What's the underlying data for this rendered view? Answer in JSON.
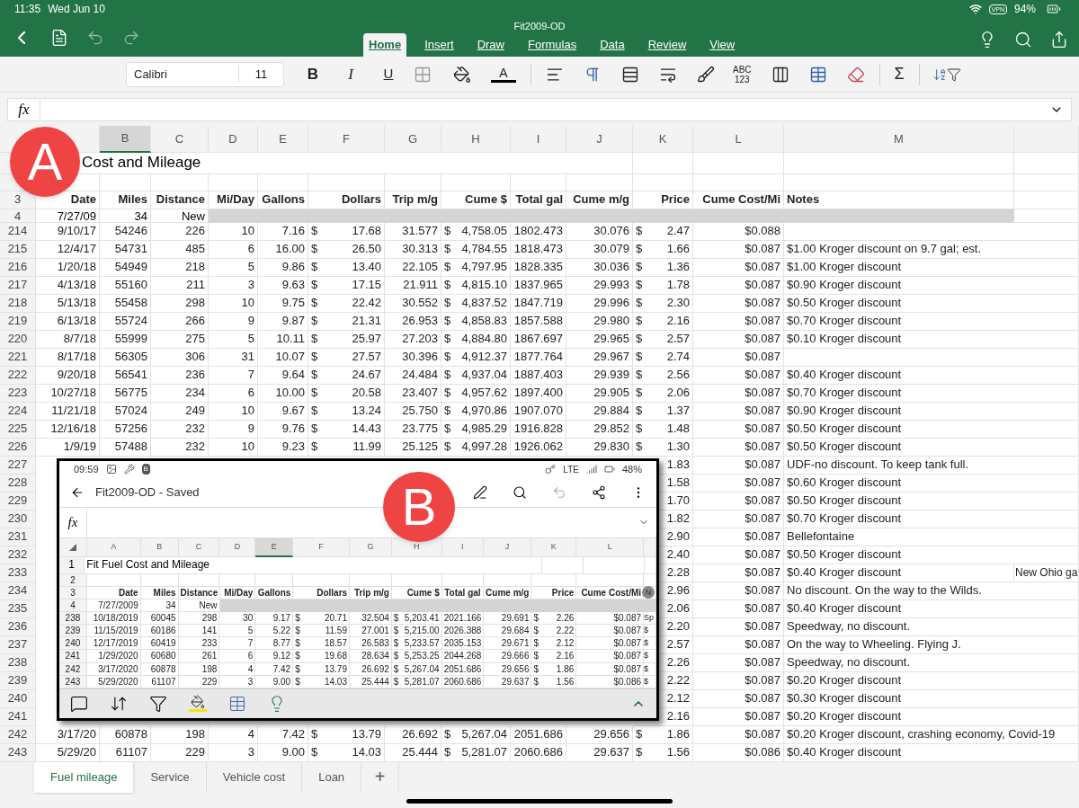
{
  "status_bar": {
    "time": "11:35",
    "date": "Wed Jun 10",
    "vpn": "VPN",
    "battery": "94%"
  },
  "title_bar": {
    "title": "Fit2009-OD"
  },
  "ribbon_tabs": [
    {
      "label": "Home",
      "selected": true
    },
    {
      "label": "Insert",
      "selected": false
    },
    {
      "label": "Draw",
      "selected": false
    },
    {
      "label": "Formulas",
      "selected": false
    },
    {
      "label": "Data",
      "selected": false
    },
    {
      "label": "Review",
      "selected": false
    },
    {
      "label": "View",
      "selected": false
    }
  ],
  "toolbar": {
    "font": "Calibri",
    "size": "11",
    "bold": "B",
    "italic": "I",
    "underline": "U",
    "font_color": "A",
    "spelling": "ABC",
    "numbers": "123",
    "sum": "Σ"
  },
  "formula_bar": {
    "label": "fx"
  },
  "callouts": [
    "A",
    "B"
  ],
  "grid": {
    "columns": [
      {
        "label": "B",
        "selected": true
      },
      {
        "label": "C",
        "selected": false
      },
      {
        "label": "D",
        "selected": false
      },
      {
        "label": "E",
        "selected": false
      },
      {
        "label": "F",
        "selected": false
      },
      {
        "label": "G",
        "selected": false
      },
      {
        "label": "H",
        "selected": false
      },
      {
        "label": "I",
        "selected": false
      },
      {
        "label": "J",
        "selected": false
      },
      {
        "label": "K",
        "selected": false
      },
      {
        "label": "L",
        "selected": false
      },
      {
        "label": "M",
        "selected": false
      }
    ],
    "title": "Cost and Mileage",
    "header_row": "3",
    "headers": [
      "Date",
      "Miles",
      "Distance",
      "Mi/Day",
      "Gallons",
      "Dollars",
      "Trip m/g",
      "Cume $",
      "Total gal",
      "Cume m/g",
      "Price",
      "Cume Cost/Mi",
      "Notes"
    ],
    "first_row": {
      "row": "4",
      "cells": [
        "7/27/09",
        "34",
        "New"
      ]
    },
    "rows": [
      {
        "kind": "full",
        "row": "214",
        "cells": [
          "9/10/17",
          "54246",
          "226",
          "10",
          "7.16",
          "$ 17.68",
          "31.577",
          "$ 4,758.05",
          "1802.473",
          "30.076",
          "$ 2.47",
          "$0.088"
        ]
      },
      {
        "kind": "full",
        "row": "215",
        "cells": [
          "12/4/17",
          "54731",
          "485",
          "6",
          "16.00",
          "$ 26.50",
          "30.313",
          "$ 4,784.55",
          "1818.473",
          "30.079",
          "$ 1.66",
          "$0.087"
        ],
        "note": "$1.00 Kroger discount on 9.7 gal; est."
      },
      {
        "kind": "full",
        "row": "216",
        "cells": [
          "1/20/18",
          "54949",
          "218",
          "5",
          "9.86",
          "$ 13.40",
          "22.105",
          "$ 4,797.95",
          "1828.335",
          "30.036",
          "$ 1.36",
          "$0.087"
        ],
        "note": "$1.00 Kroger discount"
      },
      {
        "kind": "full",
        "row": "217",
        "cells": [
          "4/13/18",
          "55160",
          "211",
          "3",
          "9.63",
          "$ 17.15",
          "21.911",
          "$ 4,815.10",
          "1837.965",
          "29.993",
          "$ 1.78",
          "$0.087"
        ],
        "note": "$0.90 Kroger discount"
      },
      {
        "kind": "full",
        "row": "218",
        "cells": [
          "5/13/18",
          "55458",
          "298",
          "10",
          "9.75",
          "$ 22.42",
          "30.552",
          "$ 4,837.52",
          "1847.719",
          "29.996",
          "$ 2.30",
          "$0.087"
        ],
        "note": "$0.50 Kroger discount"
      },
      {
        "kind": "full",
        "row": "219",
        "cells": [
          "6/13/18",
          "55724",
          "266",
          "9",
          "9.87",
          "$ 21.31",
          "26.953",
          "$ 4,858.83",
          "1857.588",
          "29.980",
          "$ 2.16",
          "$0.087"
        ],
        "note": "$0.70 Kroger discount"
      },
      {
        "kind": "full",
        "row": "220",
        "cells": [
          "8/7/18",
          "55999",
          "275",
          "5",
          "10.11",
          "$ 25.97",
          "27.203",
          "$ 4,884.80",
          "1867.697",
          "29.965",
          "$ 2.57",
          "$0.087"
        ],
        "note": "$0.10 Kroger discount"
      },
      {
        "kind": "full",
        "row": "221",
        "cells": [
          "8/17/18",
          "56305",
          "306",
          "31",
          "10.07",
          "$ 27.57",
          "30.396",
          "$ 4,912.37",
          "1877.764",
          "29.967",
          "$ 2.74",
          "$0.087"
        ]
      },
      {
        "kind": "full",
        "row": "222",
        "cells": [
          "9/20/18",
          "56541",
          "236",
          "7",
          "9.64",
          "$ 24.67",
          "24.484",
          "$ 4,937.04",
          "1887.403",
          "29.939",
          "$ 2.56",
          "$0.087"
        ],
        "note": "$0.40 Kroger discount"
      },
      {
        "kind": "full",
        "row": "223",
        "cells": [
          "10/27/18",
          "56775",
          "234",
          "6",
          "10.00",
          "$ 20.58",
          "23.407",
          "$ 4,957.62",
          "1897.400",
          "29.905",
          "$ 2.06",
          "$0.087"
        ],
        "note": "$0.70 Kroger discount"
      },
      {
        "kind": "full",
        "row": "224",
        "cells": [
          "11/21/18",
          "57024",
          "249",
          "10",
          "9.67",
          "$ 13.24",
          "25.750",
          "$ 4,970.86",
          "1907.070",
          "29.884",
          "$ 1.37",
          "$0.087"
        ],
        "note": "$0.90 Kroger discount"
      },
      {
        "kind": "full",
        "row": "225",
        "cells": [
          "12/16/18",
          "57256",
          "232",
          "9",
          "9.76",
          "$ 14.43",
          "23.775",
          "$ 4,985.29",
          "1916.828",
          "29.852",
          "$ 1.48",
          "$0.087"
        ],
        "note": "$0.50 Kroger discount"
      },
      {
        "kind": "full",
        "row": "226",
        "cells": [
          "1/9/19",
          "57488",
          "232",
          "10",
          "9.23",
          "$ 11.99",
          "25.125",
          "$ 4,997.28",
          "1926.062",
          "29.830",
          "$ 1.30",
          "$0.087"
        ],
        "note": "$0.50 Kroger discount"
      },
      {
        "kind": "partial",
        "row": "227",
        "price": "1.83",
        "cost": "$0.087",
        "note": "UDF-no discount. To keep tank full."
      },
      {
        "kind": "partial",
        "row": "228",
        "price": "1.58",
        "cost": "$0.087",
        "note": "$0.60 Kroger discount"
      },
      {
        "kind": "partial",
        "row": "229",
        "price": "1.70",
        "cost": "$0.087",
        "note": "$0.50 Kroger discount"
      },
      {
        "kind": "partial",
        "row": "230",
        "price": "1.82",
        "cost": "$0.087",
        "note": "$0.70 Kroger discount"
      },
      {
        "kind": "partial",
        "row": "231",
        "price": "2.90",
        "cost": "$0.087",
        "note": "Bellefontaine"
      },
      {
        "kind": "partial",
        "row": "232",
        "price": "2.40",
        "cost": "$0.087",
        "note": "$0.50 Kroger discount"
      },
      {
        "kind": "partial",
        "row": "233",
        "price": "2.28",
        "cost": "$0.087",
        "note": "$0.40 Kroger discount",
        "extra": "New Ohio ga"
      },
      {
        "kind": "partial",
        "row": "234",
        "price": "2.96",
        "cost": "$0.087",
        "note": "No discount. On the way to the Wilds."
      },
      {
        "kind": "partial",
        "row": "235",
        "price": "2.06",
        "cost": "$0.087",
        "note": "$0.40 Kroger discount"
      },
      {
        "kind": "partial",
        "row": "236",
        "price": "2.20",
        "cost": "$0.087",
        "note": "Speedway, no discount."
      },
      {
        "kind": "partial",
        "row": "237",
        "price": "2.57",
        "cost": "$0.087",
        "note": "On the way to Wheeling. Flying J."
      },
      {
        "kind": "partial",
        "row": "238",
        "price": "2.26",
        "cost": "$0.087",
        "note": "Speedway, no discount."
      },
      {
        "kind": "partial",
        "row": "239",
        "price": "2.22",
        "cost": "$0.087",
        "note": "$0.20 Kroger discount"
      },
      {
        "kind": "partial",
        "row": "240",
        "price": "2.12",
        "cost": "$0.087",
        "note": "$0.30 Kroger discount"
      },
      {
        "kind": "partial",
        "row": "241",
        "price": "2.16",
        "cost": "$0.087",
        "note": "$0.20 Kroger discount"
      },
      {
        "kind": "full",
        "row": "242",
        "cells": [
          "3/17/20",
          "60878",
          "198",
          "4",
          "7.42",
          "$ 13.79",
          "26.692",
          "$ 5,267.04",
          "2051.686",
          "29.656",
          "$ 1.86",
          "$0.087"
        ],
        "note": "$0.20 Kroger discount, crashing economy, Covid-19"
      },
      {
        "kind": "full",
        "row": "243",
        "cells": [
          "5/29/20",
          "61107",
          "229",
          "3",
          "9.00",
          "$ 14.03",
          "25.444",
          "$ 5,281.07",
          "2060.686",
          "29.637",
          "$ 1.56",
          "$0.086"
        ],
        "note": "$0.40 Kroger discount"
      }
    ]
  },
  "inset": {
    "status": {
      "time": "09:59",
      "badge": "B",
      "network": "LTE",
      "battery": "48%"
    },
    "title": "Fit2009-OD - Saved",
    "formula_label": "fx",
    "columns": [
      {
        "label": "A",
        "selected": false
      },
      {
        "label": "B",
        "selected": false
      },
      {
        "label": "C",
        "selected": false
      },
      {
        "label": "D",
        "selected": false
      },
      {
        "label": "E",
        "selected": true
      },
      {
        "label": "F",
        "selected": false
      },
      {
        "label": "G",
        "selected": false
      },
      {
        "label": "H",
        "selected": false
      },
      {
        "label": "I",
        "selected": false
      },
      {
        "label": "J",
        "selected": false
      },
      {
        "label": "K",
        "selected": false
      },
      {
        "label": "L",
        "selected": false
      }
    ],
    "row_labels": [
      "1",
      "2",
      "3",
      "4"
    ],
    "title_cell": "Fit Fuel Cost and Mileage",
    "headers": [
      "Date",
      "Miles",
      "Distance",
      "Mi/Day",
      "Gallons",
      "Dollars",
      "Trip m/g",
      "Cume $",
      "Total gal",
      "Cume m/g",
      "Price",
      "Cume Cost/Mi"
    ],
    "handle": "N",
    "first_row": [
      "7/27/2009",
      "34",
      "New"
    ],
    "rows": [
      {
        "row": "238",
        "cells": [
          "10/18/2019",
          "60045",
          "298",
          "30",
          "9.17",
          "$ 20.71",
          "32.504",
          "$ 5,203.41",
          "2021.166",
          "29.691",
          "$ 2.26",
          "$0.087"
        ],
        "note": "Sp"
      },
      {
        "row": "239",
        "cells": [
          "11/15/2019",
          "60186",
          "141",
          "5",
          "5.22",
          "$ 11.59",
          "27.001",
          "$ 5,215.00",
          "2026.388",
          "29.684",
          "$ 2.22",
          "$0.087"
        ],
        "note": "$"
      },
      {
        "row": "240",
        "cells": [
          "12/17/2019",
          "60419",
          "233",
          "7",
          "8.77",
          "$ 18.57",
          "26.583",
          "$ 5,233.57",
          "2035.153",
          "29.671",
          "$ 2.12",
          "$0.087"
        ],
        "note": "$"
      },
      {
        "row": "241",
        "cells": [
          "1/29/2020",
          "60680",
          "261",
          "6",
          "9.12",
          "$ 19.68",
          "28.634",
          "$ 5,253.25",
          "2044.268",
          "29.666",
          "$ 2.16",
          "$0.087"
        ],
        "note": "$"
      },
      {
        "row": "242",
        "cells": [
          "3/17/2020",
          "60878",
          "198",
          "4",
          "7.42",
          "$ 13.79",
          "26.692",
          "$ 5,267.04",
          "2051.686",
          "29.656",
          "$ 1.86",
          "$0.087"
        ],
        "note": "$"
      },
      {
        "row": "243",
        "cells": [
          "5/29/2020",
          "61107",
          "229",
          "3",
          "9.00",
          "$ 14.03",
          "25.444",
          "$ 5,281.07",
          "2060.686",
          "29.637",
          "$ 1.56",
          "$0.086"
        ],
        "note": "$"
      }
    ]
  },
  "sheet_tabs": [
    {
      "label": "Fuel mileage",
      "selected": true
    },
    {
      "label": "Service",
      "selected": false
    },
    {
      "label": "Vehicle cost",
      "selected": false
    },
    {
      "label": "Loan",
      "selected": false
    }
  ],
  "add_sheet": "+"
}
